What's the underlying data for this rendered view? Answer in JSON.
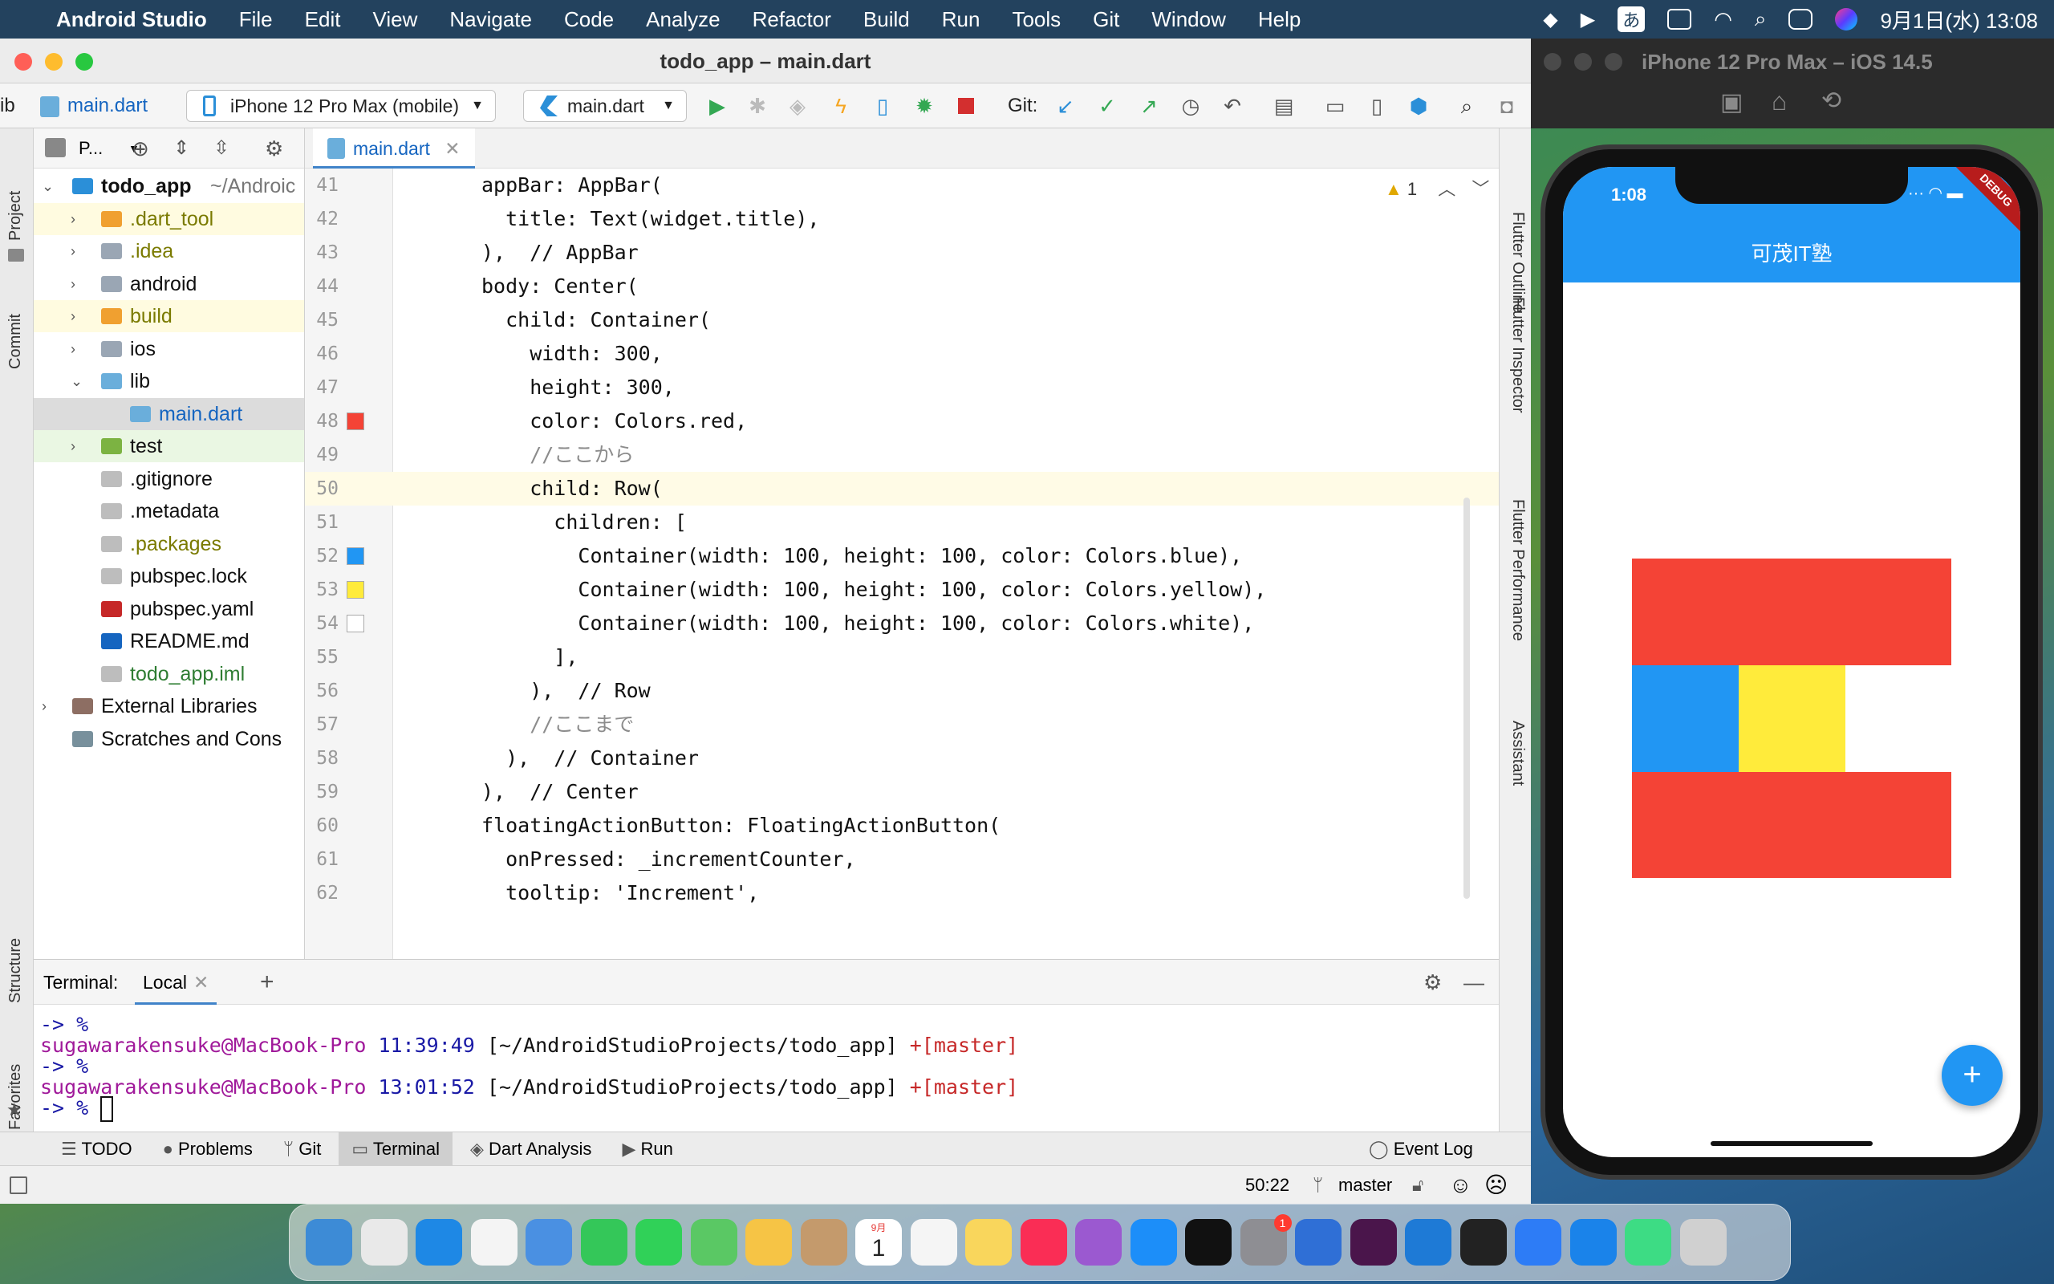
{
  "menubar": {
    "app_name": "Android Studio",
    "items": [
      "File",
      "Edit",
      "View",
      "Navigate",
      "Code",
      "Analyze",
      "Refactor",
      "Build",
      "Run",
      "Tools",
      "Git",
      "Window",
      "Help"
    ],
    "input_method": "あ",
    "datetime": "9月1日(水) 13:08"
  },
  "studio": {
    "window_title": "todo_app – main.dart",
    "toolbar": {
      "breadcrumb_root": "ib",
      "breadcrumb_file": "main.dart",
      "device_selector": "iPhone 12 Pro Max (mobile)",
      "run_config": "main.dart",
      "git_label": "Git:"
    },
    "side_tabs": {
      "left": [
        "Project",
        "Commit",
        "Structure",
        "Favorites"
      ],
      "right": [
        "Flutter Outline",
        "Flutter Inspector",
        "Flutter Performance",
        "Assistant"
      ]
    },
    "project_panel": {
      "header": "P...",
      "tree": [
        {
          "label": "todo_app",
          "suffix": "~/Androic",
          "depth": 0,
          "arrow": "expanded",
          "kind": "flutter-project",
          "bold": true,
          "color": "#111111",
          "bg": ""
        },
        {
          "label": ".dart_tool",
          "depth": 1,
          "arrow": "collapsed",
          "kind": "folder-orange",
          "color": "#7a7a00",
          "bg": "#fffbe0"
        },
        {
          "label": ".idea",
          "depth": 1,
          "arrow": "collapsed",
          "kind": "folder-gear",
          "color": "#7a7a00",
          "bg": ""
        },
        {
          "label": "android",
          "depth": 1,
          "arrow": "collapsed",
          "kind": "folder-gray",
          "color": "#111111",
          "bg": ""
        },
        {
          "label": "build",
          "depth": 1,
          "arrow": "collapsed",
          "kind": "folder-orange",
          "color": "#7a7a00",
          "bg": "#fffbe0"
        },
        {
          "label": "ios",
          "depth": 1,
          "arrow": "collapsed",
          "kind": "folder-gray",
          "color": "#111111",
          "bg": ""
        },
        {
          "label": "lib",
          "depth": 1,
          "arrow": "expanded",
          "kind": "folder-blue",
          "color": "#111111",
          "bg": ""
        },
        {
          "label": "main.dart",
          "depth": 2,
          "arrow": "",
          "kind": "dart-file",
          "color": "#1565c0",
          "bg": "#dcdcdc"
        },
        {
          "label": "test",
          "depth": 1,
          "arrow": "collapsed",
          "kind": "folder-green",
          "color": "#111111",
          "bg": "#eaf7e3"
        },
        {
          "label": ".gitignore",
          "depth": 1,
          "arrow": "",
          "kind": "file",
          "color": "#111111",
          "bg": ""
        },
        {
          "label": ".metadata",
          "depth": 1,
          "arrow": "",
          "kind": "file",
          "color": "#111111",
          "bg": ""
        },
        {
          "label": ".packages",
          "depth": 1,
          "arrow": "",
          "kind": "file",
          "color": "#7a7a00",
          "bg": ""
        },
        {
          "label": "pubspec.lock",
          "depth": 1,
          "arrow": "",
          "kind": "file",
          "color": "#111111",
          "bg": ""
        },
        {
          "label": "pubspec.yaml",
          "depth": 1,
          "arrow": "",
          "kind": "yaml-file",
          "color": "#111111",
          "bg": ""
        },
        {
          "label": "README.md",
          "depth": 1,
          "arrow": "",
          "kind": "md-file",
          "color": "#111111",
          "bg": ""
        },
        {
          "label": "todo_app.iml",
          "depth": 1,
          "arrow": "",
          "kind": "file",
          "color": "#2e7d32",
          "bg": ""
        },
        {
          "label": "External Libraries",
          "depth": 0,
          "arrow": "collapsed",
          "kind": "library",
          "color": "#111111",
          "bg": ""
        },
        {
          "label": "Scratches and Cons",
          "depth": 0,
          "arrow": "",
          "kind": "scratch",
          "color": "#111111",
          "bg": ""
        }
      ]
    },
    "editor": {
      "tab_label": "main.dart",
      "warning_count": "1",
      "lines": [
        {
          "n": "41",
          "code": "appBar: AppBar(",
          "swatch": ""
        },
        {
          "n": "42",
          "code": "  title: Text(widget.title),",
          "swatch": ""
        },
        {
          "n": "43",
          "code": "),  // AppBar",
          "swatch": ""
        },
        {
          "n": "44",
          "code": "body: Center(",
          "swatch": ""
        },
        {
          "n": "45",
          "code": "  child: Container(",
          "swatch": ""
        },
        {
          "n": "46",
          "code": "    width: 300,",
          "swatch": ""
        },
        {
          "n": "47",
          "code": "    height: 300,",
          "swatch": ""
        },
        {
          "n": "48",
          "code": "    color: Colors.red,",
          "swatch": "#f44336"
        },
        {
          "n": "49",
          "code": "    //ここから",
          "swatch": ""
        },
        {
          "n": "50",
          "code": "    child: Row(",
          "swatch": ""
        },
        {
          "n": "51",
          "code": "      children: [",
          "swatch": ""
        },
        {
          "n": "52",
          "code": "        Container(width: 100, height: 100, color: Colors.blue),",
          "swatch": "#2196f3"
        },
        {
          "n": "53",
          "code": "        Container(width: 100, height: 100, color: Colors.yellow),",
          "swatch": "#ffeb3b"
        },
        {
          "n": "54",
          "code": "        Container(width: 100, height: 100, color: Colors.white),",
          "swatch": "#ffffff"
        },
        {
          "n": "55",
          "code": "      ],",
          "swatch": ""
        },
        {
          "n": "56",
          "code": "    ),  // Row",
          "swatch": ""
        },
        {
          "n": "57",
          "code": "    //ここまで",
          "swatch": ""
        },
        {
          "n": "58",
          "code": "  ),  // Container",
          "swatch": ""
        },
        {
          "n": "59",
          "code": "),  // Center",
          "swatch": ""
        },
        {
          "n": "60",
          "code": "floatingActionButton: FloatingActionButton(",
          "swatch": ""
        },
        {
          "n": "61",
          "code": "  onPressed: _incrementCounter,",
          "swatch": ""
        },
        {
          "n": "62",
          "code": "  tooltip: 'Increment',",
          "swatch": ""
        }
      ]
    },
    "terminal": {
      "label": "Terminal:",
      "tab": "Local",
      "lines": [
        {
          "prompt": "-> %",
          "user": "",
          "time": "",
          "path": "",
          "branch": ""
        },
        {
          "prompt": "",
          "user": "sugawarakensuke@MacBook-Pro",
          "time": "11:39:49",
          "path": "[~/AndroidStudioProjects/todo_app]",
          "branch": "+[master]"
        },
        {
          "prompt": "-> %",
          "user": "",
          "time": "",
          "path": "",
          "branch": ""
        },
        {
          "prompt": "",
          "user": "sugawarakensuke@MacBook-Pro",
          "time": "13:01:52",
          "path": "[~/AndroidStudioProjects/todo_app]",
          "branch": "+[master]"
        },
        {
          "prompt": "-> %",
          "user": "",
          "time": "",
          "path": "",
          "branch": ""
        }
      ]
    },
    "bottom_tabs": [
      "TODO",
      "Problems",
      "Git",
      "Terminal",
      "Dart Analysis",
      "Run"
    ],
    "active_bottom_tab": "Terminal",
    "event_log": "Event Log",
    "status": {
      "position": "50:22",
      "branch": "master"
    }
  },
  "simulator": {
    "title": "iPhone 12 Pro Max – iOS 14.5",
    "status_time": "1:08",
    "debug_banner": "DEBUG",
    "app_title": "可茂IT塾",
    "fab_icon": "+",
    "colors": {
      "appbar": "#2196f3",
      "red": "#f44336",
      "blue": "#2196f3",
      "yellow": "#ffeb3b",
      "white": "#ffffff"
    }
  },
  "dock": {
    "calendar_month": "9月",
    "calendar_day": "1",
    "settings_badge": "1",
    "apps": [
      "finder-icon",
      "launchpad-icon",
      "safari-icon",
      "chrome-icon",
      "mail-icon",
      "facetime-icon",
      "messages-icon",
      "maps-icon",
      "photos-icon",
      "contacts-icon",
      "calendar-icon",
      "reminders-icon",
      "notes-icon",
      "music-icon",
      "podcasts-icon",
      "app-store-icon",
      "tv-icon",
      "system-preferences-icon",
      "sourcetree-icon",
      "slack-icon",
      "vscode-icon",
      "activity-monitor-icon",
      "keynote-icon",
      "xcode-icon",
      "android-studio-icon",
      "trash-icon"
    ]
  }
}
